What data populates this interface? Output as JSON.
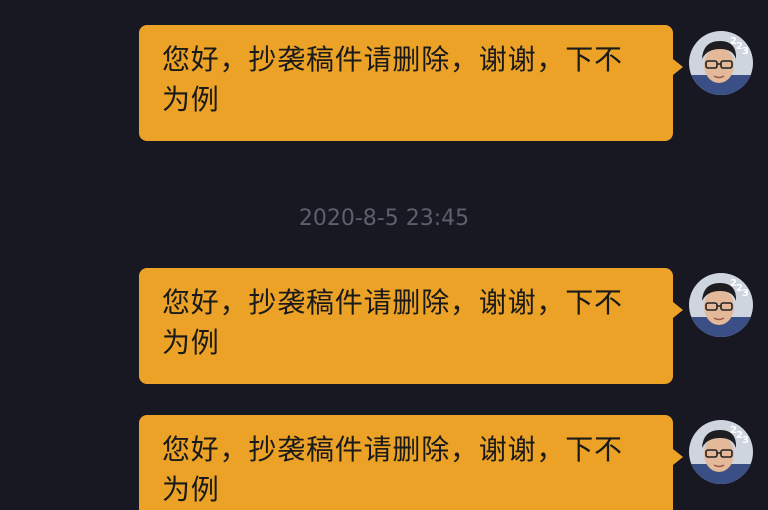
{
  "chat": {
    "timestamp": "2020-8-5 23:45",
    "messages": [
      {
        "text": "您好，抄袭稿件请删除，谢谢，下不为例",
        "avatar_icon": "user-avatar-icon"
      },
      {
        "text": "您好，抄袭稿件请删除，谢谢，下不为例",
        "avatar_icon": "user-avatar-icon"
      },
      {
        "text": "您好，抄袭稿件请删除，谢谢，下不为例",
        "avatar_icon": "user-avatar-icon"
      }
    ]
  },
  "colors": {
    "background": "#181823",
    "bubble": "#EBA227",
    "bubble_text": "#1A1A1A",
    "timestamp_text": "#5E5F6B"
  }
}
